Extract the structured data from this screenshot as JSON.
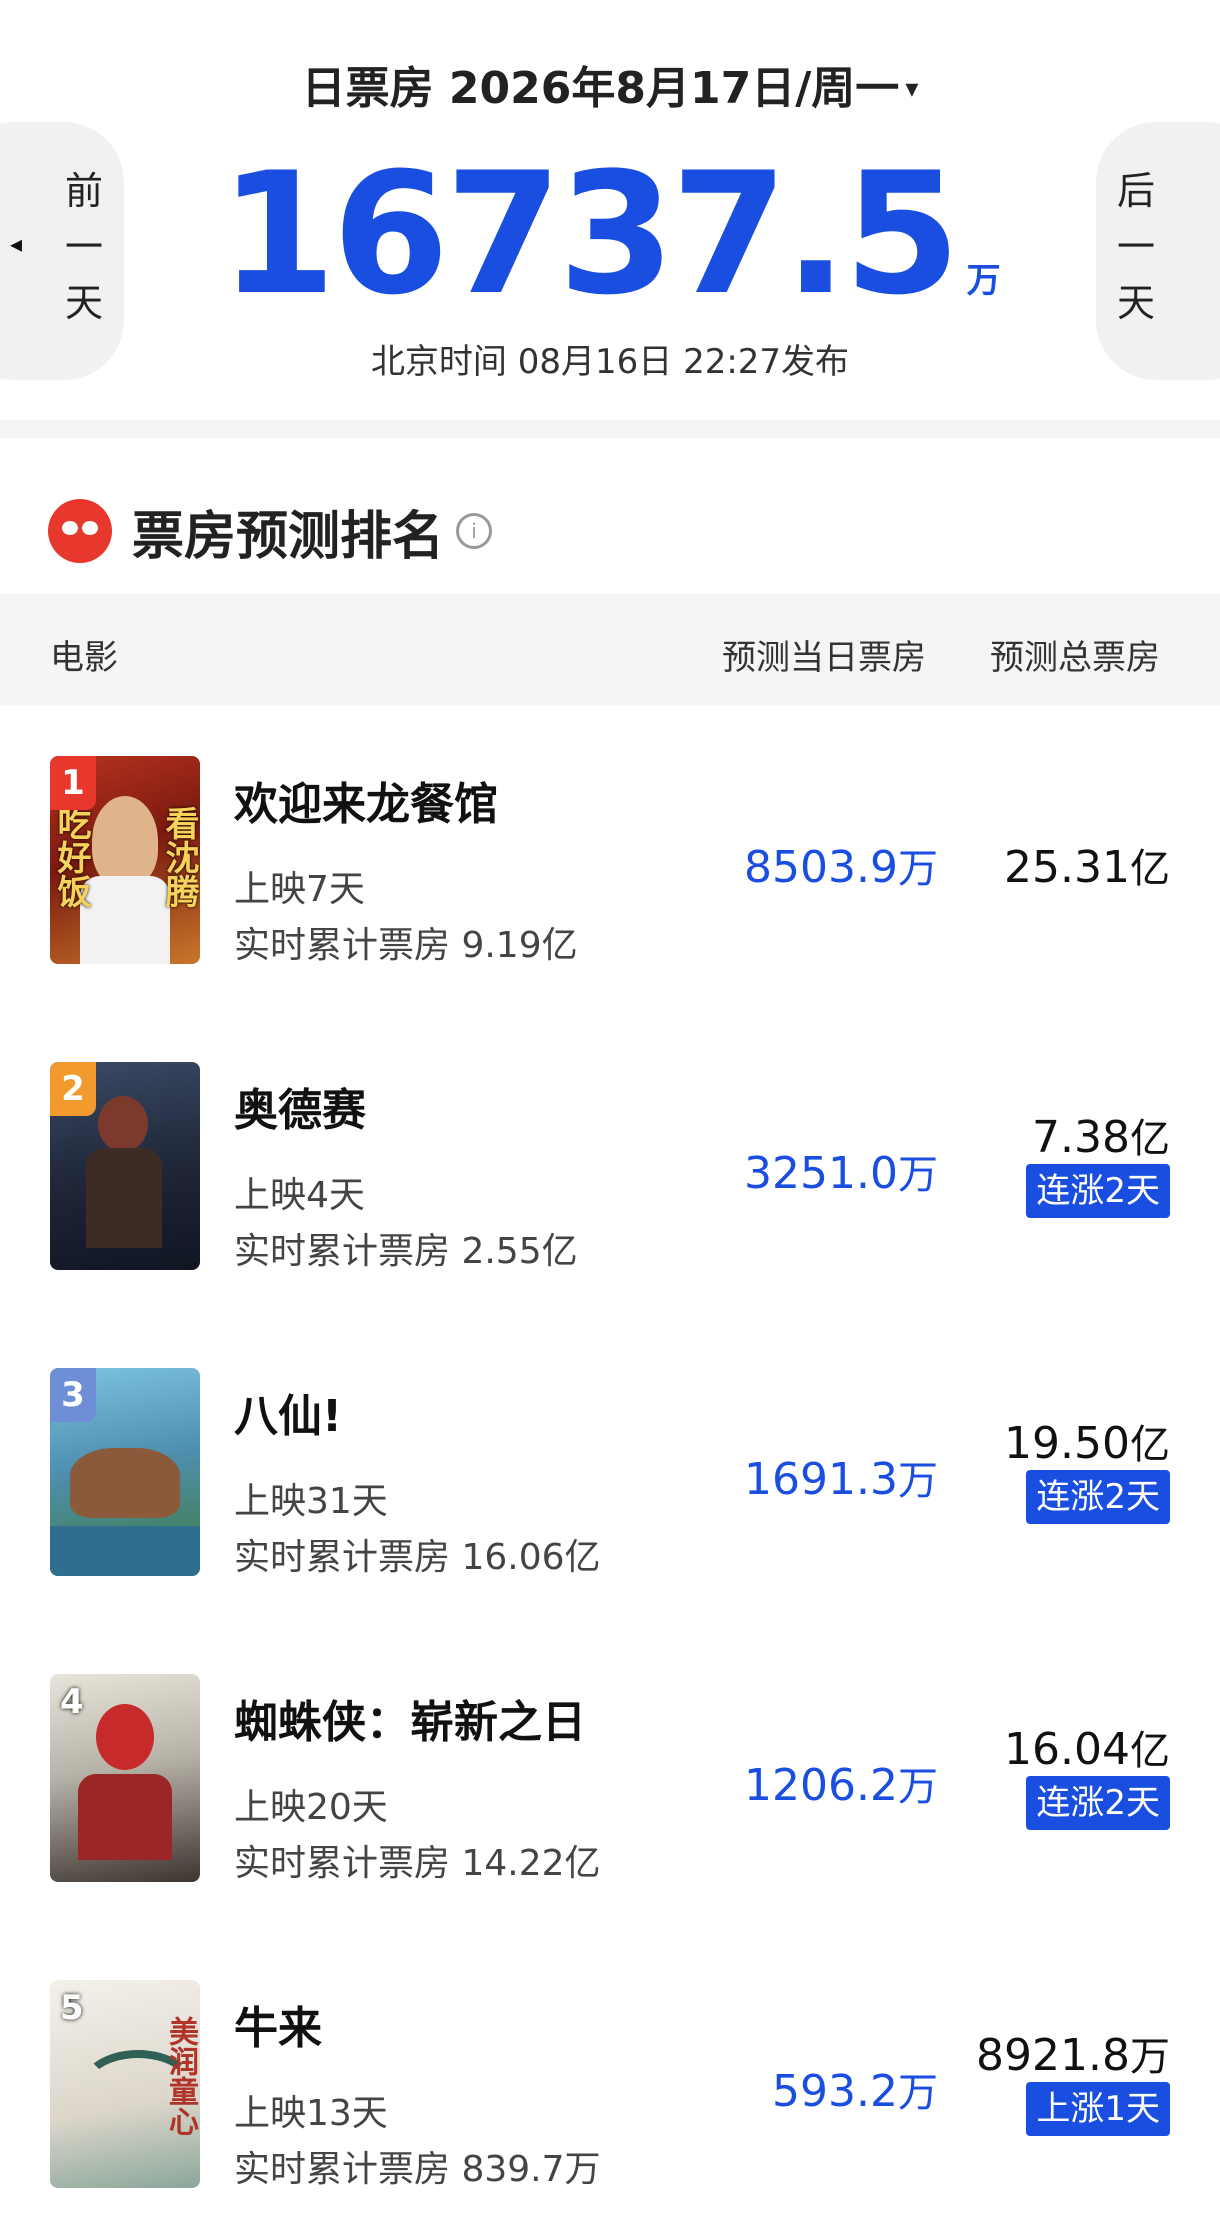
{
  "header": {
    "date_label": "日票房 2026年8月17日/周一",
    "caret": "▾",
    "prev": {
      "chars": [
        "前",
        "一",
        "天"
      ],
      "arrow": "◂"
    },
    "next": {
      "chars": [
        "后",
        "一",
        "天"
      ],
      "arrow": "▸"
    },
    "total_value": "16737.5",
    "total_unit": "万",
    "publish_text": "北京时间  08月16日  22:27发布"
  },
  "section": {
    "title": "票房预测排名",
    "info": "i"
  },
  "table": {
    "col_movie": "电影",
    "col_day": "预测当日票房",
    "col_total": "预测总票房"
  },
  "colors": {
    "accent": "#1a4ee0",
    "rank1": "#e8382d",
    "rank2": "#f29a2e",
    "rank3": "#6e8fd6"
  },
  "movies": [
    {
      "rank": "1",
      "title": "欢迎来龙餐馆",
      "days": "上映7天",
      "cum": "实时累计票房 9.19亿",
      "day_value": "8503.9",
      "day_unit": "万",
      "total_value": "25.31",
      "total_unit": "亿",
      "badge": "",
      "poster_text_left": "吃好饭",
      "poster_text_right": "看沈腾"
    },
    {
      "rank": "2",
      "title": "奥德赛",
      "days": "上映4天",
      "cum": "实时累计票房 2.55亿",
      "day_value": "3251.0",
      "day_unit": "万",
      "total_value": "7.38",
      "total_unit": "亿",
      "badge": "连涨2天",
      "poster_text_left": "",
      "poster_text_right": ""
    },
    {
      "rank": "3",
      "title": "八仙!",
      "days": "上映31天",
      "cum": "实时累计票房 16.06亿",
      "day_value": "1691.3",
      "day_unit": "万",
      "total_value": "19.50",
      "total_unit": "亿",
      "badge": "连涨2天",
      "poster_text_left": "",
      "poster_text_right": ""
    },
    {
      "rank": "4",
      "title": "蜘蛛侠：崭新之日",
      "days": "上映20天",
      "cum": "实时累计票房 14.22亿",
      "day_value": "1206.2",
      "day_unit": "万",
      "total_value": "16.04",
      "total_unit": "亿",
      "badge": "连涨2天",
      "poster_text_left": "",
      "poster_text_right": ""
    },
    {
      "rank": "5",
      "title": "牛来",
      "days": "上映13天",
      "cum": "实时累计票房 839.7万",
      "day_value": "593.2",
      "day_unit": "万",
      "total_value": "8921.8",
      "total_unit": "万",
      "badge": "上涨1天",
      "poster_text_left": "",
      "poster_text_right": "美润童心"
    }
  ]
}
